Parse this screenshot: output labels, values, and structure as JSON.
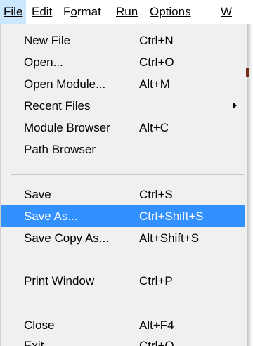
{
  "menubar": {
    "file": "File",
    "edit": "Edit",
    "format_a": "F",
    "format_u": "o",
    "format_b": "rmat",
    "run": "Run",
    "options": "Options",
    "window": "W"
  },
  "menu": {
    "new_file": {
      "label": "New File",
      "accel": "Ctrl+N"
    },
    "open": {
      "label": "Open...",
      "accel": "Ctrl+O"
    },
    "open_module": {
      "label": "Open Module...",
      "accel": "Alt+M"
    },
    "recent_files": {
      "label": "Recent Files",
      "icon": "submenu-arrow-icon"
    },
    "module_browser": {
      "label": "Module Browser",
      "accel": "Alt+C"
    },
    "path_browser": {
      "label": "Path Browser"
    },
    "save": {
      "label": "Save",
      "accel": "Ctrl+S"
    },
    "save_as": {
      "label": "Save As...",
      "accel": "Ctrl+Shift+S"
    },
    "save_copy_as": {
      "label": "Save Copy As...",
      "accel": "Alt+Shift+S"
    },
    "print_window": {
      "label": "Print Window",
      "accel": "Ctrl+P"
    },
    "close": {
      "label": "Close",
      "accel": "Alt+F4"
    },
    "exit": {
      "label": "Exit",
      "accel": "Ctrl+Q"
    }
  },
  "colors": {
    "highlight": "#3390ff",
    "active_menubar": "#cce8ff",
    "menu_bg": "#f0f0f0"
  }
}
